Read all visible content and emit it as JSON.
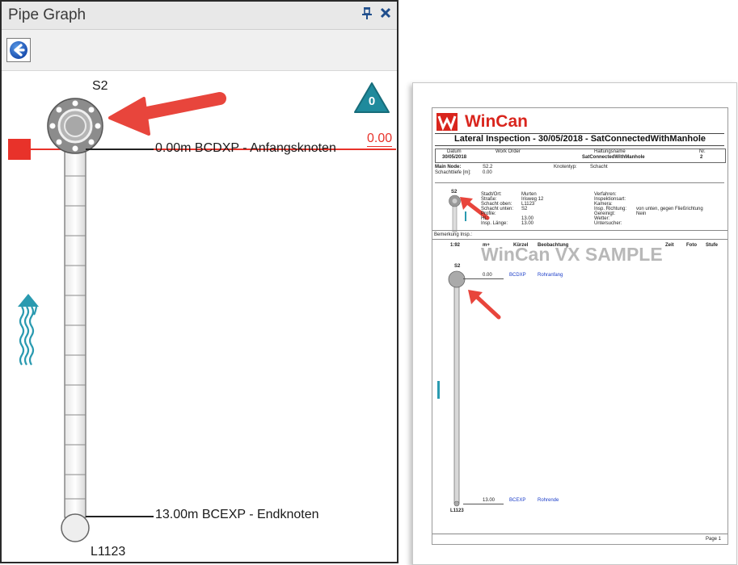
{
  "panel": {
    "title": "Pipe Graph",
    "pin_icon": "pin-icon",
    "close_icon": "close-icon",
    "back_icon": "back-arrow-icon"
  },
  "graph": {
    "start_node": "S2",
    "end_node": "L1123",
    "badge_count": "0",
    "start_observation": "0.00m BCDXP - Anfangsknoten",
    "end_observation": "13.00m BCEXP - Endknoten",
    "position_value": "0.00",
    "flow_icon": "flow-direction-icon"
  },
  "colors": {
    "accent_red": "#e8322a",
    "badge_teal": "#1f8a9c",
    "flow_teal": "#2a9ab0"
  },
  "report": {
    "brand": "WinCan",
    "heading": "Lateral Inspection - 30/05/2018 - SatConnectedWithManhole",
    "cols": {
      "datum_label": "Datum",
      "datum_value": "30/05/2018",
      "work_order_label": "Work Order",
      "haltung_label": "Haltungsname",
      "haltung_value": "SatConnectedWithManhole",
      "nr_label": "Nr.",
      "nr_value": "2"
    },
    "main_node_label": "Main Node:",
    "main_node_value": "S2.2",
    "schachttiefe_label": "Schachttiefe [m]:",
    "schachttiefe_value": "0.00",
    "knotentyp_label": "Knotentyp:",
    "knotentyp_value": "Schacht",
    "mini_node": "S2",
    "left_info": [
      {
        "k": "Stadt/Ort:",
        "v": "Murten"
      },
      {
        "k": "Straße:",
        "v": "Irisweg 12"
      },
      {
        "k": "Schacht oben:",
        "v": "L1123"
      },
      {
        "k": "Schacht unten:",
        "v": "S2"
      },
      {
        "k": "Profile:",
        "v": ""
      },
      {
        "k": "HL:",
        "v": "13.00"
      },
      {
        "k": "Insp. Länge:",
        "v": "13.00"
      }
    ],
    "right_info": [
      {
        "k": "Verfahren:",
        "v": ""
      },
      {
        "k": "Inspektionsart:",
        "v": ""
      },
      {
        "k": "Kamera:",
        "v": ""
      },
      {
        "k": "Insp. Richtung:",
        "v": "von unten, gegen Fließrichtung"
      },
      {
        "k": "Gereinigt:",
        "v": "Nein"
      },
      {
        "k": "Wetter:",
        "v": ""
      },
      {
        "k": "Untersucher:",
        "v": ""
      }
    ],
    "bemerkung_label": "Bemerkung Insp.:",
    "table_headers": {
      "scale": "1:92",
      "m": "m+",
      "kurzel": "Kürzel",
      "beobachtung": "Beobachtung",
      "zeit": "Zeit",
      "foto": "Foto",
      "stufe": "Stufe"
    },
    "watermark": "WinCan VX SAMPLE",
    "mini_top_node": "S2",
    "mini_bottom_node": "L1123",
    "obs1": {
      "m": "0.00",
      "code": "BCDXP",
      "text": "Rohranfang"
    },
    "obs2": {
      "m": "13.00",
      "code": "BCEXP",
      "text": "Rohrende"
    },
    "page_label": "Page 1"
  }
}
